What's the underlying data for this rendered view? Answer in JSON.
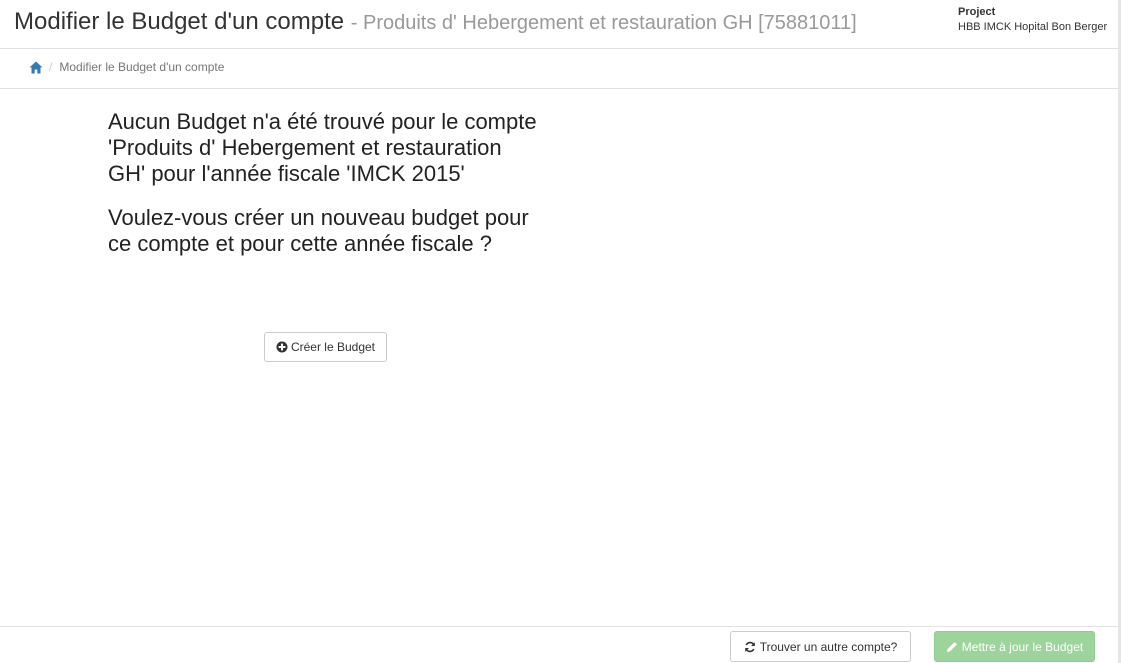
{
  "header": {
    "title": "Modifier le Budget d'un compte",
    "subtitle": "- Produits d' Hebergement et restauration GH [75881011]",
    "project_label": "Project",
    "project_name": "HBB IMCK Hopital Bon Berger"
  },
  "breadcrumb": {
    "separator": "/",
    "current": "Modifier le Budget d'un compte",
    "home_icon": "home-icon"
  },
  "main": {
    "not_found_message": "Aucun Budget n'a été trouvé pour le compte 'Produits d' Hebergement et restauration GH' pour l'année fiscale 'IMCK 2015'",
    "question": "Voulez-vous créer un nouveau budget pour ce compte et pour cette année fiscale ?",
    "create_button_label": "Créer le Budget",
    "create_button_icon": "plus-circle-icon"
  },
  "footer": {
    "find_button_label": "Trouver un autre compte?",
    "find_button_icon": "refresh-icon",
    "update_button_label": "Mettre à jour le Budget",
    "update_button_icon": "pencil-icon",
    "update_button_color": "#9cd49c"
  }
}
